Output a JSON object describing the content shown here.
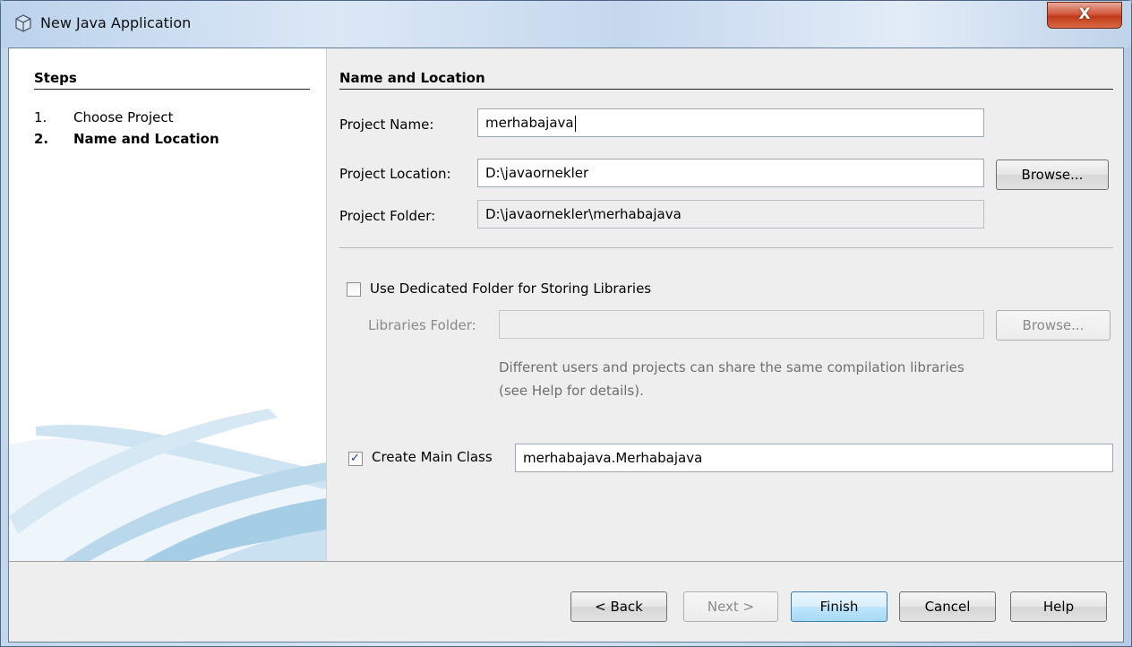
{
  "window": {
    "title": "New Java Application",
    "close_label": "X"
  },
  "steps": {
    "heading": "Steps",
    "items": [
      {
        "num": "1.",
        "label": "Choose Project"
      },
      {
        "num": "2.",
        "label": "Name and Location"
      }
    ]
  },
  "form": {
    "heading": "Name and Location",
    "project_name_label": "Project Name:",
    "project_name_value": "merhabajava",
    "project_location_label": "Project Location:",
    "project_location_value": "D:\\javaornekler",
    "browse_label": "Browse...",
    "project_folder_label": "Project Folder:",
    "project_folder_value": "D:\\javaornekler\\merhabajava",
    "dedicated_folder_label": "Use Dedicated Folder for Storing Libraries",
    "dedicated_folder_checked": false,
    "libraries_folder_label": "Libraries Folder:",
    "libraries_folder_value": "",
    "libraries_browse_label": "Browse...",
    "hint": "Different users and projects can share the same compilation libraries (see Help for details).",
    "create_main_label": "Create Main Class",
    "create_main_checked": true,
    "main_class_value": "merhabajava.Merhabajava"
  },
  "buttons": {
    "back": "< Back",
    "next": "Next >",
    "finish": "Finish",
    "cancel": "Cancel",
    "help": "Help"
  },
  "colors": {
    "titlebar": "#c4d7ec",
    "close": "#c03a18",
    "panel": "#eeeeee",
    "default_button": "#bee6fd"
  }
}
